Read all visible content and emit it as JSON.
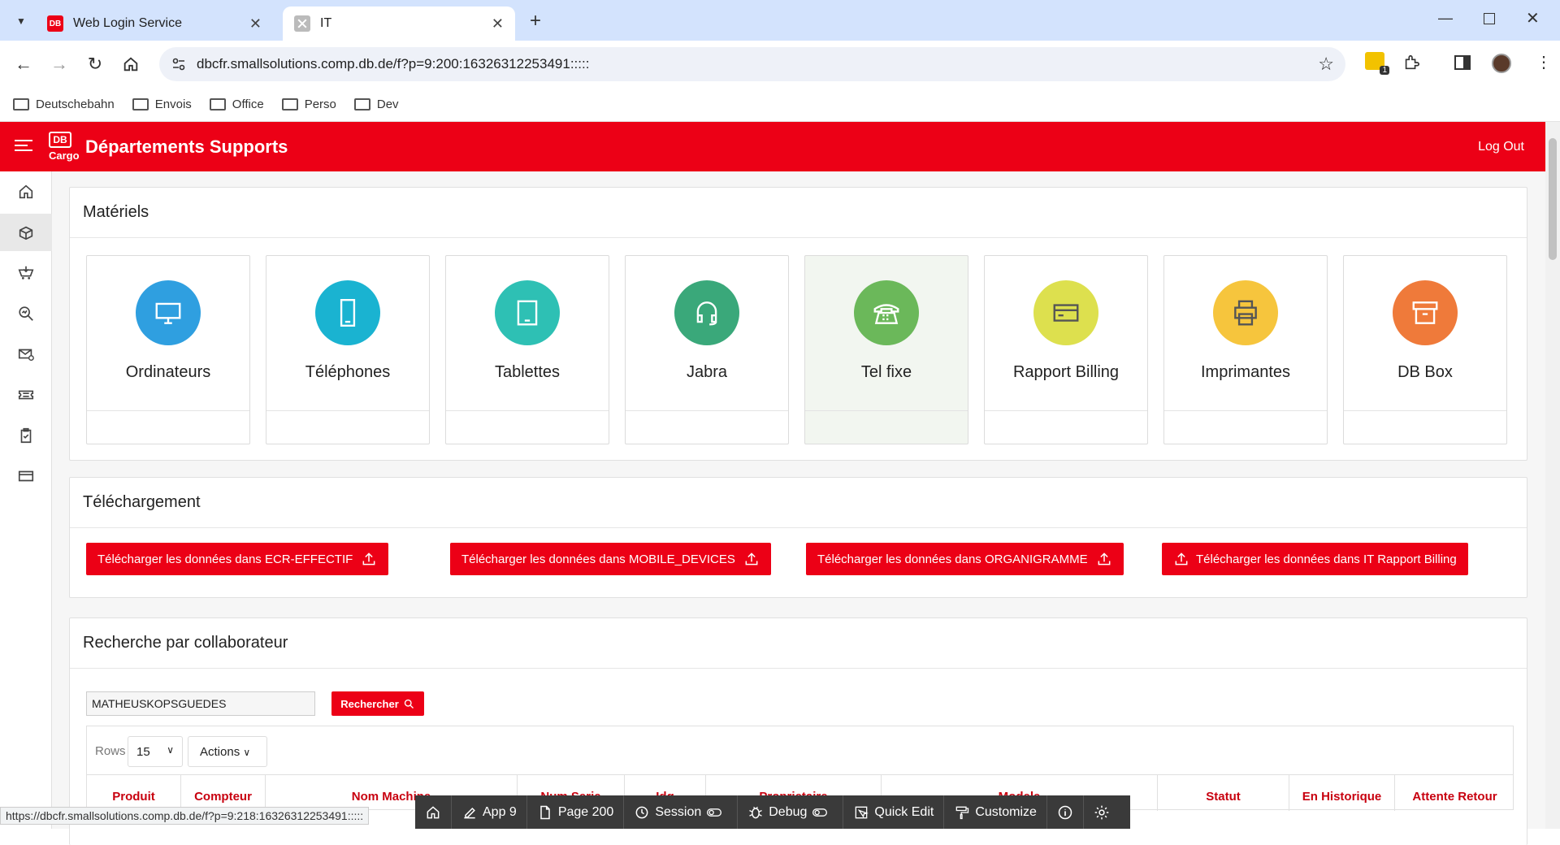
{
  "browser": {
    "tabs": [
      {
        "title": "Web Login Service",
        "favicon": "DB"
      },
      {
        "title": "IT"
      }
    ],
    "url": "dbcfr.smallsolutions.comp.db.de/f?p=9:200:16326312253491:::::",
    "bookmarks": [
      "Deutschebahn",
      "Envois",
      "Office",
      "Perso",
      "Dev"
    ],
    "extension_badge": "1"
  },
  "app": {
    "logo": "DB",
    "logo_sub": "Cargo",
    "title": "Départements Supports",
    "logout": "Log Out",
    "brand_color": "#ec0016"
  },
  "materiels": {
    "title": "Matériels",
    "cards": [
      {
        "label": "Ordinateurs",
        "icon": "monitor-icon",
        "color": "#2f9fe0"
      },
      {
        "label": "Téléphones",
        "icon": "mobile-phone-icon",
        "color": "#1ab3d1"
      },
      {
        "label": "Tablettes",
        "icon": "tablet-icon",
        "color": "#2ec0b4"
      },
      {
        "label": "Jabra",
        "icon": "headset-icon",
        "color": "#3aa87a"
      },
      {
        "label": "Tel fixe",
        "icon": "desk-phone-icon",
        "color": "#6bb85a"
      },
      {
        "label": "Rapport Billing",
        "icon": "credit-card-icon",
        "color": "#dde04e"
      },
      {
        "label": "Imprimantes",
        "icon": "printer-icon",
        "color": "#f6c53d"
      },
      {
        "label": "DB Box",
        "icon": "archive-box-icon",
        "color": "#ef7a3a"
      }
    ]
  },
  "telechargement": {
    "title": "Téléchargement",
    "buttons": [
      "Télécharger les données dans ECR-EFFECTIF",
      "Télécharger les données dans MOBILE_DEVICES",
      "Télécharger les données dans ORGANIGRAMME",
      "Télécharger les données dans IT Rapport Billing"
    ]
  },
  "recherche": {
    "title": "Recherche par collaborateur",
    "input_value": "MATHEUSKOPSGUEDES",
    "search_button": "Rechercher",
    "rows_label": "Rows",
    "rows_value": "15",
    "actions_label": "Actions",
    "columns": [
      "Produit",
      "Compteur",
      "Nom Machine",
      "Num Serie",
      "Idg",
      "Proprietaire",
      "Modele",
      "Statut",
      "En Historique",
      "Attente Retour"
    ]
  },
  "status_url": "https://dbcfr.smallsolutions.comp.db.de/f?p=9:218:16326312253491:::::",
  "devbar": {
    "app": "App 9",
    "page": "Page 200",
    "session": "Session",
    "debug": "Debug",
    "quick_edit": "Quick Edit",
    "customize": "Customize"
  }
}
